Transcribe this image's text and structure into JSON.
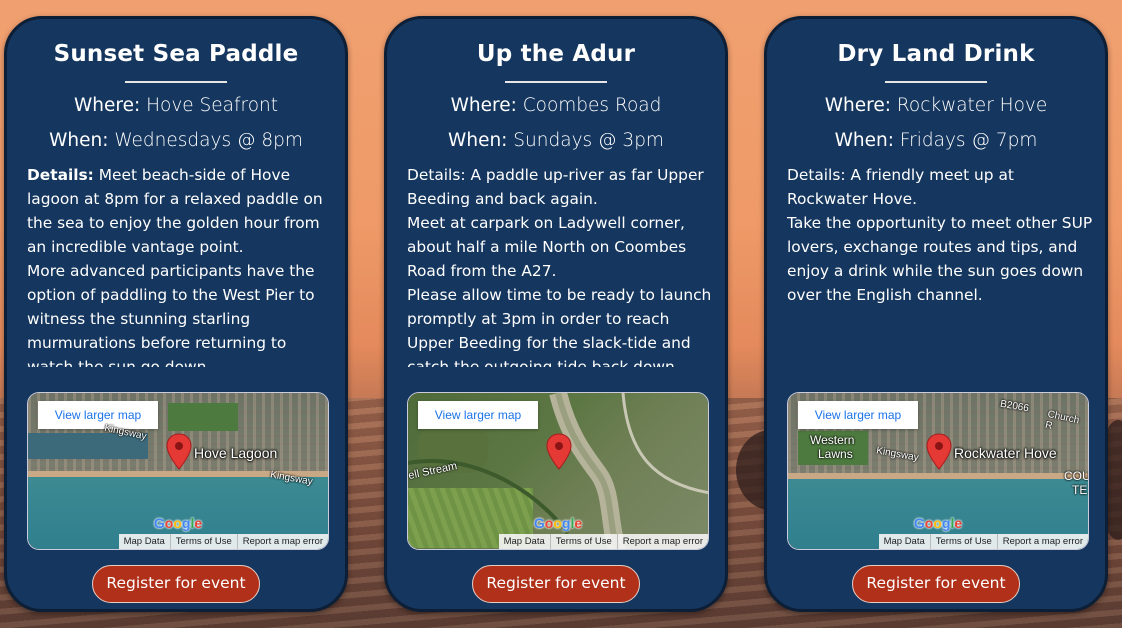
{
  "events": [
    {
      "title": "Sunset Sea Paddle",
      "where_key": "Where:",
      "where_value": "Hove Seafront",
      "when_key": "When:",
      "when_value": "Wednesdays @ 8pm",
      "details_label": "Details:",
      "details_paragraphs": [
        "Meet beach-side of Hove lagoon at 8pm for a relaxed paddle on the sea to enjoy the golden hour from an incredible vantage point.",
        "More advanced participants have the option of paddling to the West Pier to witness the stunning starling murmurations before returning to watch the sun go down."
      ],
      "map": {
        "view_larger": "View larger map",
        "place_label": "Hove Lagoon",
        "road_labels": [
          "Kingsway",
          "Kingsway"
        ],
        "google": "Google",
        "footer": [
          "Map Data",
          "Terms of Use",
          "Report a map error"
        ]
      },
      "register_label": "Register for event"
    },
    {
      "title": "Up the Adur",
      "where_key": "Where:",
      "where_value": "Coombes Road",
      "when_key": "When:",
      "when_value": "Sundays @ 3pm",
      "details_label": "Details:",
      "details_paragraphs": [
        "A paddle up-river as far Upper Beeding and back again.",
        "Meet at carpark on Ladywell corner, about half a mile North on Coombes Road from the A27.",
        "Please allow time to be ready to launch promptly at 3pm in order to reach Upper Beeding for the slack-tide and catch the outgoing tide back down-river."
      ],
      "map": {
        "view_larger": "View larger map",
        "road_labels": [
          "ell Stream"
        ],
        "google": "Google",
        "footer": [
          "Map Data",
          "Terms of Use",
          "Report a map error"
        ]
      },
      "register_label": "Register for event"
    },
    {
      "title": "Dry Land Drink",
      "where_key": "Where:",
      "where_value": "Rockwater Hove",
      "when_key": "When:",
      "when_value": "Fridays @ 7pm",
      "details_label": "Details:",
      "details_paragraphs": [
        "A friendly meet up at Rockwater Hove.",
        "Take the opportunity to meet other SUP lovers, exchange routes and tips, and enjoy a drink while the sun goes down over the English channel."
      ],
      "map": {
        "view_larger": "View larger map",
        "place_label": "Rockwater Hove",
        "road_labels": [
          "Western",
          "Lawns",
          "Kingsway",
          "B2066",
          "Church R",
          "COU",
          "TE"
        ],
        "google": "Google",
        "footer": [
          "Map Data",
          "Terms of Use",
          "Report a map error"
        ]
      },
      "register_label": "Register for event"
    }
  ],
  "colors": {
    "card_bg": "#15365e",
    "button_bg": "#b0301a",
    "map_pin": "#e53935",
    "link_blue": "#1a73e8"
  }
}
